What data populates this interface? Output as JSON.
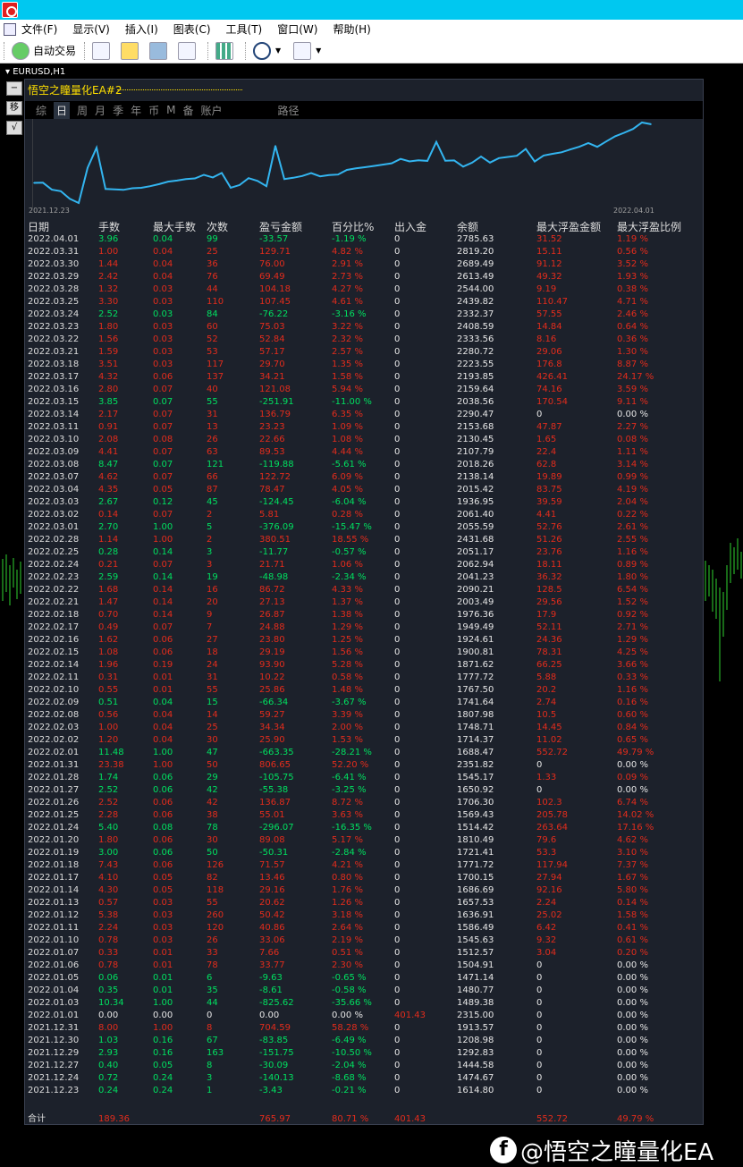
{
  "menus": [
    "文件(F)",
    "显示(V)",
    "插入(I)",
    "图表(C)",
    "工具(T)",
    "窗口(W)",
    "帮助(H)"
  ],
  "toolbar": {
    "autotrade_label": "自动交易"
  },
  "chart": {
    "tab_label": "EURUSD,H1"
  },
  "ea": {
    "title": "悟空之瞳量化EA#2",
    "side_buttons": [
      "−",
      "移",
      "√"
    ],
    "tabs": [
      "综",
      "日",
      "周",
      "月",
      "季",
      "年",
      "币",
      "M",
      "备",
      "账户",
      "路径"
    ],
    "active_tab": "日",
    "graph_start": "2021.12.23",
    "graph_end": "2022.04.01",
    "columns": [
      "日期",
      "手数",
      "最大手数",
      "次数",
      "盈亏金额",
      "百分比%",
      "出入金",
      "余额",
      "最大浮盈金额",
      "最大浮盈比例"
    ]
  },
  "chart_data": {
    "type": "line",
    "x": [
      "2021.12.23",
      "2021.12.24",
      "2021.12.27",
      "2021.12.28",
      "2021.12.29",
      "2021.12.30",
      "2021.12.31",
      "2022.01.01",
      "2022.01.03",
      "2022.01.04",
      "2022.01.05",
      "2022.01.06",
      "2022.01.07",
      "2022.01.10",
      "2022.01.11",
      "2022.01.12",
      "2022.01.13",
      "2022.01.14",
      "2022.01.17",
      "2022.01.18",
      "2022.01.19",
      "2022.01.20",
      "2022.01.24",
      "2022.01.25",
      "2022.01.26",
      "2022.01.27",
      "2022.01.28",
      "2022.01.31",
      "2022.02.01",
      "2022.02.02",
      "2022.02.03",
      "2022.02.08",
      "2022.02.09",
      "2022.02.10",
      "2022.02.11",
      "2022.02.14",
      "2022.02.15",
      "2022.02.16",
      "2022.02.17",
      "2022.02.18",
      "2022.02.21",
      "2022.02.22",
      "2022.02.23",
      "2022.02.24",
      "2022.02.25",
      "2022.02.28",
      "2022.03.01",
      "2022.03.02",
      "2022.03.03",
      "2022.03.04",
      "2022.03.07",
      "2022.03.08",
      "2022.03.09",
      "2022.03.10",
      "2022.03.11",
      "2022.03.14",
      "2022.03.15",
      "2022.03.16",
      "2022.03.17",
      "2022.03.18",
      "2022.03.21",
      "2022.03.22",
      "2022.03.23",
      "2022.03.24",
      "2022.03.25",
      "2022.03.28",
      "2022.03.29",
      "2022.03.30",
      "2022.03.31",
      "2022.04.01"
    ],
    "values": [
      1611.23,
      1614.8,
      1474.67,
      1444.58,
      1292.83,
      1208.98,
      1913.57,
      2315.0,
      1489.38,
      1480.77,
      1471.14,
      1504.91,
      1512.57,
      1545.63,
      1586.49,
      1636.91,
      1657.53,
      1686.69,
      1700.15,
      1771.72,
      1721.41,
      1810.49,
      1514.42,
      1569.43,
      1706.3,
      1650.92,
      1545.17,
      2351.82,
      1688.47,
      1714.37,
      1748.71,
      1807.98,
      1741.64,
      1767.5,
      1777.72,
      1871.62,
      1900.81,
      1924.61,
      1949.49,
      1976.36,
      2003.49,
      2090.21,
      2041.23,
      2062.94,
      2051.17,
      2431.68,
      2055.59,
      2061.4,
      1936.95,
      2015.42,
      2138.14,
      2018.26,
      2107.79,
      2130.45,
      2153.68,
      2290.47,
      2038.56,
      2159.64,
      2193.85,
      2223.55,
      2280.72,
      2333.56,
      2408.59,
      2332.37,
      2439.82,
      2544.0,
      2613.49,
      2689.49,
      2819.2,
      2785.63
    ],
    "xlabel": "",
    "ylabel": ""
  },
  "rows": [
    [
      "2022.04.01",
      "3.96",
      "0.04",
      "99",
      "-33.57",
      "-1.19 %",
      "0",
      "2785.63",
      "31.52",
      "1.19 %",
      "g"
    ],
    [
      "2022.03.31",
      "1.00",
      "0.04",
      "25",
      "129.71",
      "4.82 %",
      "0",
      "2819.20",
      "15.11",
      "0.56 %",
      "r"
    ],
    [
      "2022.03.30",
      "1.44",
      "0.04",
      "36",
      "76.00",
      "2.91 %",
      "0",
      "2689.49",
      "91.12",
      "3.52 %",
      "r"
    ],
    [
      "2022.03.29",
      "2.42",
      "0.04",
      "76",
      "69.49",
      "2.73 %",
      "0",
      "2613.49",
      "49.32",
      "1.93 %",
      "r"
    ],
    [
      "2022.03.28",
      "1.32",
      "0.03",
      "44",
      "104.18",
      "4.27 %",
      "0",
      "2544.00",
      "9.19",
      "0.38 %",
      "r"
    ],
    [
      "2022.03.25",
      "3.30",
      "0.03",
      "110",
      "107.45",
      "4.61 %",
      "0",
      "2439.82",
      "110.47",
      "4.71 %",
      "r"
    ],
    [
      "2022.03.24",
      "2.52",
      "0.03",
      "84",
      "-76.22",
      "-3.16 %",
      "0",
      "2332.37",
      "57.55",
      "2.46 %",
      "g"
    ],
    [
      "2022.03.23",
      "1.80",
      "0.03",
      "60",
      "75.03",
      "3.22 %",
      "0",
      "2408.59",
      "14.84",
      "0.64 %",
      "r"
    ],
    [
      "2022.03.22",
      "1.56",
      "0.03",
      "52",
      "52.84",
      "2.32 %",
      "0",
      "2333.56",
      "8.16",
      "0.36 %",
      "r"
    ],
    [
      "2022.03.21",
      "1.59",
      "0.03",
      "53",
      "57.17",
      "2.57 %",
      "0",
      "2280.72",
      "29.06",
      "1.30 %",
      "r"
    ],
    [
      "2022.03.18",
      "3.51",
      "0.03",
      "117",
      "29.70",
      "1.35 %",
      "0",
      "2223.55",
      "176.8",
      "8.87 %",
      "r"
    ],
    [
      "2022.03.17",
      "4.32",
      "0.06",
      "137",
      "34.21",
      "1.58 %",
      "0",
      "2193.85",
      "426.41",
      "24.17 %",
      "r"
    ],
    [
      "2022.03.16",
      "2.80",
      "0.07",
      "40",
      "121.08",
      "5.94 %",
      "0",
      "2159.64",
      "74.16",
      "3.59 %",
      "r"
    ],
    [
      "2022.03.15",
      "3.85",
      "0.07",
      "55",
      "-251.91",
      "-11.00 %",
      "0",
      "2038.56",
      "170.54",
      "9.11 %",
      "g"
    ],
    [
      "2022.03.14",
      "2.17",
      "0.07",
      "31",
      "136.79",
      "6.35 %",
      "0",
      "2290.47",
      "0",
      "0.00 %",
      "r"
    ],
    [
      "2022.03.11",
      "0.91",
      "0.07",
      "13",
      "23.23",
      "1.09 %",
      "0",
      "2153.68",
      "47.87",
      "2.27 %",
      "r"
    ],
    [
      "2022.03.10",
      "2.08",
      "0.08",
      "26",
      "22.66",
      "1.08 %",
      "0",
      "2130.45",
      "1.65",
      "0.08 %",
      "r"
    ],
    [
      "2022.03.09",
      "4.41",
      "0.07",
      "63",
      "89.53",
      "4.44 %",
      "0",
      "2107.79",
      "22.4",
      "1.11 %",
      "r"
    ],
    [
      "2022.03.08",
      "8.47",
      "0.07",
      "121",
      "-119.88",
      "-5.61 %",
      "0",
      "2018.26",
      "62.8",
      "3.14 %",
      "g"
    ],
    [
      "2022.03.07",
      "4.62",
      "0.07",
      "66",
      "122.72",
      "6.09 %",
      "0",
      "2138.14",
      "19.89",
      "0.99 %",
      "r"
    ],
    [
      "2022.03.04",
      "4.35",
      "0.05",
      "87",
      "78.47",
      "4.05 %",
      "0",
      "2015.42",
      "83.75",
      "4.19 %",
      "r"
    ],
    [
      "2022.03.03",
      "2.67",
      "0.12",
      "45",
      "-124.45",
      "-6.04 %",
      "0",
      "1936.95",
      "39.59",
      "2.04 %",
      "g"
    ],
    [
      "2022.03.02",
      "0.14",
      "0.07",
      "2",
      "5.81",
      "0.28 %",
      "0",
      "2061.40",
      "4.41",
      "0.22 %",
      "r"
    ],
    [
      "2022.03.01",
      "2.70",
      "1.00",
      "5",
      "-376.09",
      "-15.47 %",
      "0",
      "2055.59",
      "52.76",
      "2.61 %",
      "g"
    ],
    [
      "2022.02.28",
      "1.14",
      "1.00",
      "2",
      "380.51",
      "18.55 %",
      "0",
      "2431.68",
      "51.26",
      "2.55 %",
      "r"
    ],
    [
      "2022.02.25",
      "0.28",
      "0.14",
      "3",
      "-11.77",
      "-0.57 %",
      "0",
      "2051.17",
      "23.76",
      "1.16 %",
      "g"
    ],
    [
      "2022.02.24",
      "0.21",
      "0.07",
      "3",
      "21.71",
      "1.06 %",
      "0",
      "2062.94",
      "18.11",
      "0.89 %",
      "r"
    ],
    [
      "2022.02.23",
      "2.59",
      "0.14",
      "19",
      "-48.98",
      "-2.34 %",
      "0",
      "2041.23",
      "36.32",
      "1.80 %",
      "g"
    ],
    [
      "2022.02.22",
      "1.68",
      "0.14",
      "16",
      "86.72",
      "4.33 %",
      "0",
      "2090.21",
      "128.5",
      "6.54 %",
      "r"
    ],
    [
      "2022.02.21",
      "1.47",
      "0.14",
      "20",
      "27.13",
      "1.37 %",
      "0",
      "2003.49",
      "29.56",
      "1.52 %",
      "r"
    ],
    [
      "2022.02.18",
      "0.70",
      "0.14",
      "9",
      "26.87",
      "1.38 %",
      "0",
      "1976.36",
      "17.9",
      "0.92 %",
      "r"
    ],
    [
      "2022.02.17",
      "0.49",
      "0.07",
      "7",
      "24.88",
      "1.29 %",
      "0",
      "1949.49",
      "52.11",
      "2.71 %",
      "r"
    ],
    [
      "2022.02.16",
      "1.62",
      "0.06",
      "27",
      "23.80",
      "1.25 %",
      "0",
      "1924.61",
      "24.36",
      "1.29 %",
      "r"
    ],
    [
      "2022.02.15",
      "1.08",
      "0.06",
      "18",
      "29.19",
      "1.56 %",
      "0",
      "1900.81",
      "78.31",
      "4.25 %",
      "r"
    ],
    [
      "2022.02.14",
      "1.96",
      "0.19",
      "24",
      "93.90",
      "5.28 %",
      "0",
      "1871.62",
      "66.25",
      "3.66 %",
      "r"
    ],
    [
      "2022.02.11",
      "0.31",
      "0.01",
      "31",
      "10.22",
      "0.58 %",
      "0",
      "1777.72",
      "5.88",
      "0.33 %",
      "r"
    ],
    [
      "2022.02.10",
      "0.55",
      "0.01",
      "55",
      "25.86",
      "1.48 %",
      "0",
      "1767.50",
      "20.2",
      "1.16 %",
      "r"
    ],
    [
      "2022.02.09",
      "0.51",
      "0.04",
      "15",
      "-66.34",
      "-3.67 %",
      "0",
      "1741.64",
      "2.74",
      "0.16 %",
      "g"
    ],
    [
      "2022.02.08",
      "0.56",
      "0.04",
      "14",
      "59.27",
      "3.39 %",
      "0",
      "1807.98",
      "10.5",
      "0.60 %",
      "r"
    ],
    [
      "2022.02.03",
      "1.00",
      "0.04",
      "25",
      "34.34",
      "2.00 %",
      "0",
      "1748.71",
      "14.45",
      "0.84 %",
      "r"
    ],
    [
      "2022.02.02",
      "1.20",
      "0.04",
      "30",
      "25.90",
      "1.53 %",
      "0",
      "1714.37",
      "11.02",
      "0.65 %",
      "r"
    ],
    [
      "2022.02.01",
      "11.48",
      "1.00",
      "47",
      "-663.35",
      "-28.21 %",
      "0",
      "1688.47",
      "552.72",
      "49.79 %",
      "g"
    ],
    [
      "2022.01.31",
      "23.38",
      "1.00",
      "50",
      "806.65",
      "52.20 %",
      "0",
      "2351.82",
      "0",
      "0.00 %",
      "r"
    ],
    [
      "2022.01.28",
      "1.74",
      "0.06",
      "29",
      "-105.75",
      "-6.41 %",
      "0",
      "1545.17",
      "1.33",
      "0.09 %",
      "g"
    ],
    [
      "2022.01.27",
      "2.52",
      "0.06",
      "42",
      "-55.38",
      "-3.25 %",
      "0",
      "1650.92",
      "0",
      "0.00 %",
      "g"
    ],
    [
      "2022.01.26",
      "2.52",
      "0.06",
      "42",
      "136.87",
      "8.72 %",
      "0",
      "1706.30",
      "102.3",
      "6.74 %",
      "r"
    ],
    [
      "2022.01.25",
      "2.28",
      "0.06",
      "38",
      "55.01",
      "3.63 %",
      "0",
      "1569.43",
      "205.78",
      "14.02 %",
      "r"
    ],
    [
      "2022.01.24",
      "5.40",
      "0.08",
      "78",
      "-296.07",
      "-16.35 %",
      "0",
      "1514.42",
      "263.64",
      "17.16 %",
      "g"
    ],
    [
      "2022.01.20",
      "1.80",
      "0.06",
      "30",
      "89.08",
      "5.17 %",
      "0",
      "1810.49",
      "79.6",
      "4.62 %",
      "r"
    ],
    [
      "2022.01.19",
      "3.00",
      "0.06",
      "50",
      "-50.31",
      "-2.84 %",
      "0",
      "1721.41",
      "53.3",
      "3.10 %",
      "g"
    ],
    [
      "2022.01.18",
      "7.43",
      "0.06",
      "126",
      "71.57",
      "4.21 %",
      "0",
      "1771.72",
      "117.94",
      "7.37 %",
      "r"
    ],
    [
      "2022.01.17",
      "4.10",
      "0.05",
      "82",
      "13.46",
      "0.80 %",
      "0",
      "1700.15",
      "27.94",
      "1.67 %",
      "r"
    ],
    [
      "2022.01.14",
      "4.30",
      "0.05",
      "118",
      "29.16",
      "1.76 %",
      "0",
      "1686.69",
      "92.16",
      "5.80 %",
      "r"
    ],
    [
      "2022.01.13",
      "0.57",
      "0.03",
      "55",
      "20.62",
      "1.26 %",
      "0",
      "1657.53",
      "2.24",
      "0.14 %",
      "r"
    ],
    [
      "2022.01.12",
      "5.38",
      "0.03",
      "260",
      "50.42",
      "3.18 %",
      "0",
      "1636.91",
      "25.02",
      "1.58 %",
      "r"
    ],
    [
      "2022.01.11",
      "2.24",
      "0.03",
      "120",
      "40.86",
      "2.64 %",
      "0",
      "1586.49",
      "6.42",
      "0.41 %",
      "r"
    ],
    [
      "2022.01.10",
      "0.78",
      "0.03",
      "26",
      "33.06",
      "2.19 %",
      "0",
      "1545.63",
      "9.32",
      "0.61 %",
      "r"
    ],
    [
      "2022.01.07",
      "0.33",
      "0.01",
      "33",
      "7.66",
      "0.51 %",
      "0",
      "1512.57",
      "3.04",
      "0.20 %",
      "r"
    ],
    [
      "2022.01.06",
      "0.78",
      "0.01",
      "78",
      "33.77",
      "2.30 %",
      "0",
      "1504.91",
      "0",
      "0.00 %",
      "r"
    ],
    [
      "2022.01.05",
      "0.06",
      "0.01",
      "6",
      "-9.63",
      "-0.65 %",
      "0",
      "1471.14",
      "0",
      "0.00 %",
      "g"
    ],
    [
      "2022.01.04",
      "0.35",
      "0.01",
      "35",
      "-8.61",
      "-0.58 %",
      "0",
      "1480.77",
      "0",
      "0.00 %",
      "g"
    ],
    [
      "2022.01.03",
      "10.34",
      "1.00",
      "44",
      "-825.62",
      "-35.66 %",
      "0",
      "1489.38",
      "0",
      "0.00 %",
      "g"
    ],
    [
      "2022.01.01",
      "0.00",
      "0.00",
      "0",
      "0.00",
      "0.00 %",
      "401.43",
      "2315.00",
      "0",
      "0.00 %",
      "w"
    ],
    [
      "2021.12.31",
      "8.00",
      "1.00",
      "8",
      "704.59",
      "58.28 %",
      "0",
      "1913.57",
      "0",
      "0.00 %",
      "r"
    ],
    [
      "2021.12.30",
      "1.03",
      "0.16",
      "67",
      "-83.85",
      "-6.49 %",
      "0",
      "1208.98",
      "0",
      "0.00 %",
      "g"
    ],
    [
      "2021.12.29",
      "2.93",
      "0.16",
      "163",
      "-151.75",
      "-10.50 %",
      "0",
      "1292.83",
      "0",
      "0.00 %",
      "g"
    ],
    [
      "2021.12.27",
      "0.40",
      "0.05",
      "8",
      "-30.09",
      "-2.04 %",
      "0",
      "1444.58",
      "0",
      "0.00 %",
      "g"
    ],
    [
      "2021.12.24",
      "0.72",
      "0.24",
      "3",
      "-140.13",
      "-8.68 %",
      "0",
      "1474.67",
      "0",
      "0.00 %",
      "g"
    ],
    [
      "2021.12.23",
      "0.24",
      "0.24",
      "1",
      "-3.43",
      "-0.21 %",
      "0",
      "1614.80",
      "0",
      "0.00 %",
      "g"
    ]
  ],
  "summary": {
    "label": "合计",
    "lots": "189.36",
    "profit": "765.97",
    "percent": "80.71 %",
    "deposit": "401.43",
    "max_float": "552.72",
    "max_float_pct": "49.79 %"
  },
  "watermark": "@悟空之瞳量化EA",
  "colors": {
    "positive": "#e32c1c",
    "negative": "#00e060",
    "line": "#33b5f0",
    "panel_bg": "#1c212b",
    "title_bar": "#00c8f0"
  }
}
